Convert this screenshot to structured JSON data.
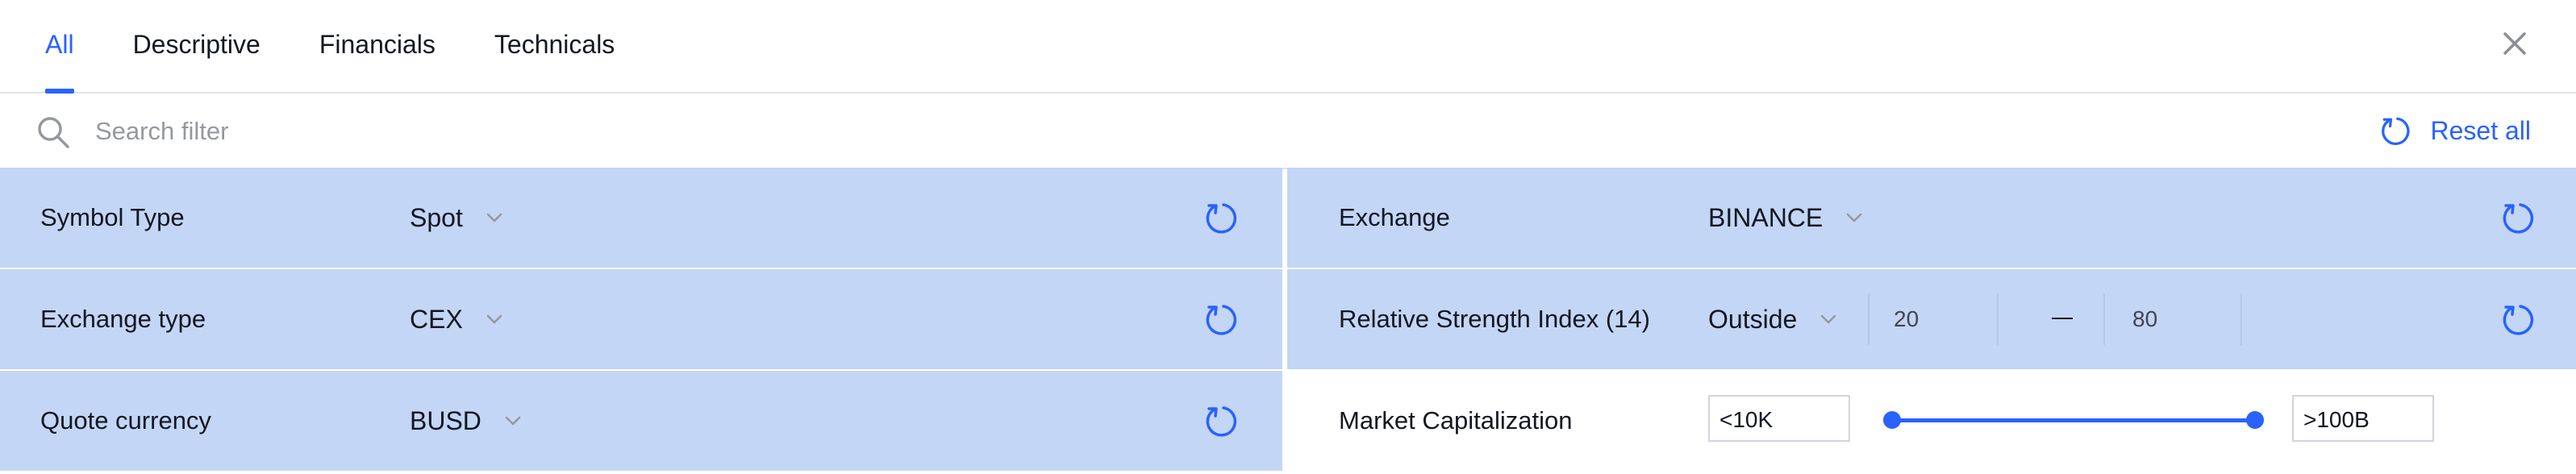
{
  "tabs": [
    {
      "label": "All",
      "active": true
    },
    {
      "label": "Descriptive",
      "active": false
    },
    {
      "label": "Financials",
      "active": false
    },
    {
      "label": "Technicals",
      "active": false
    }
  ],
  "search": {
    "placeholder": "Search filter",
    "value": ""
  },
  "reset_all_label": "Reset all",
  "colors": {
    "accent": "#2962ff",
    "highlight": "#c3d6f5",
    "border": "#e0e3eb"
  },
  "filters": {
    "symbol_type": {
      "label": "Symbol Type",
      "value": "Spot"
    },
    "exchange_type": {
      "label": "Exchange type",
      "value": "CEX"
    },
    "quote_currency": {
      "label": "Quote currency",
      "value": "BUSD"
    },
    "exchange": {
      "label": "Exchange",
      "value": "BINANCE"
    },
    "rsi": {
      "label": "Relative Strength Index (14)",
      "value": "Outside",
      "from": "20",
      "to": "80"
    },
    "market_cap": {
      "label": "Market Capitalization",
      "min": "<10K",
      "max": ">100B",
      "range_fraction": [
        0,
        1
      ]
    }
  },
  "icons": {
    "search": "search-icon",
    "close": "close-icon",
    "reset": "reset-icon",
    "dropdown": "chevron-down-icon"
  }
}
